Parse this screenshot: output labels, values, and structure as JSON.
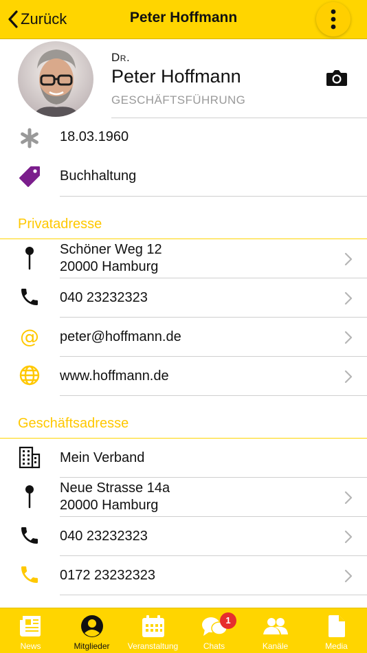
{
  "header": {
    "back_label": "Zurück",
    "title": "Peter Hoffmann"
  },
  "profile": {
    "prefix": "Dr.",
    "name": "Peter Hoffmann",
    "role": "GESCHÄFTSFÜHRUNG"
  },
  "details": [
    {
      "icon": "asterisk-icon",
      "text": "18.03.1960"
    },
    {
      "icon": "tag-icon",
      "text": "Buchhaltung"
    }
  ],
  "private": {
    "heading": "Privatadresse",
    "rows": [
      {
        "icon": "pin-icon",
        "line1": "Schöner Weg 12",
        "line2": "20000 Hamburg"
      },
      {
        "icon": "phone-icon",
        "text": "040 23232323"
      },
      {
        "icon": "at-icon",
        "text": "peter@hoffmann.de"
      },
      {
        "icon": "globe-icon",
        "text": "www.hoffmann.de"
      }
    ]
  },
  "business": {
    "heading": "Geschäftsadresse",
    "rows": [
      {
        "icon": "building-icon",
        "text": "Mein Verband"
      },
      {
        "icon": "pin-icon",
        "line1": "Neue Strasse 14a",
        "line2": "20000 Hamburg"
      },
      {
        "icon": "phone-icon",
        "text": "040 23232323"
      },
      {
        "icon": "mobile-phone-icon",
        "text": "0172 23232323"
      }
    ]
  },
  "tabs": [
    {
      "label": "News",
      "icon": "newspaper-icon"
    },
    {
      "label": "Mitglieder",
      "icon": "person-circle-icon",
      "active": true
    },
    {
      "label": "Veranstaltung",
      "icon": "calendar-icon"
    },
    {
      "label": "Chats",
      "icon": "chat-bubbles-icon",
      "badge": "1"
    },
    {
      "label": "Kanäle",
      "icon": "group-icon"
    },
    {
      "label": "Media",
      "icon": "document-icon"
    }
  ],
  "colors": {
    "accent": "#FFD500",
    "section_text": "#FFC800",
    "tag_purple": "#7B1E8C",
    "badge_red": "#E62E2E"
  }
}
